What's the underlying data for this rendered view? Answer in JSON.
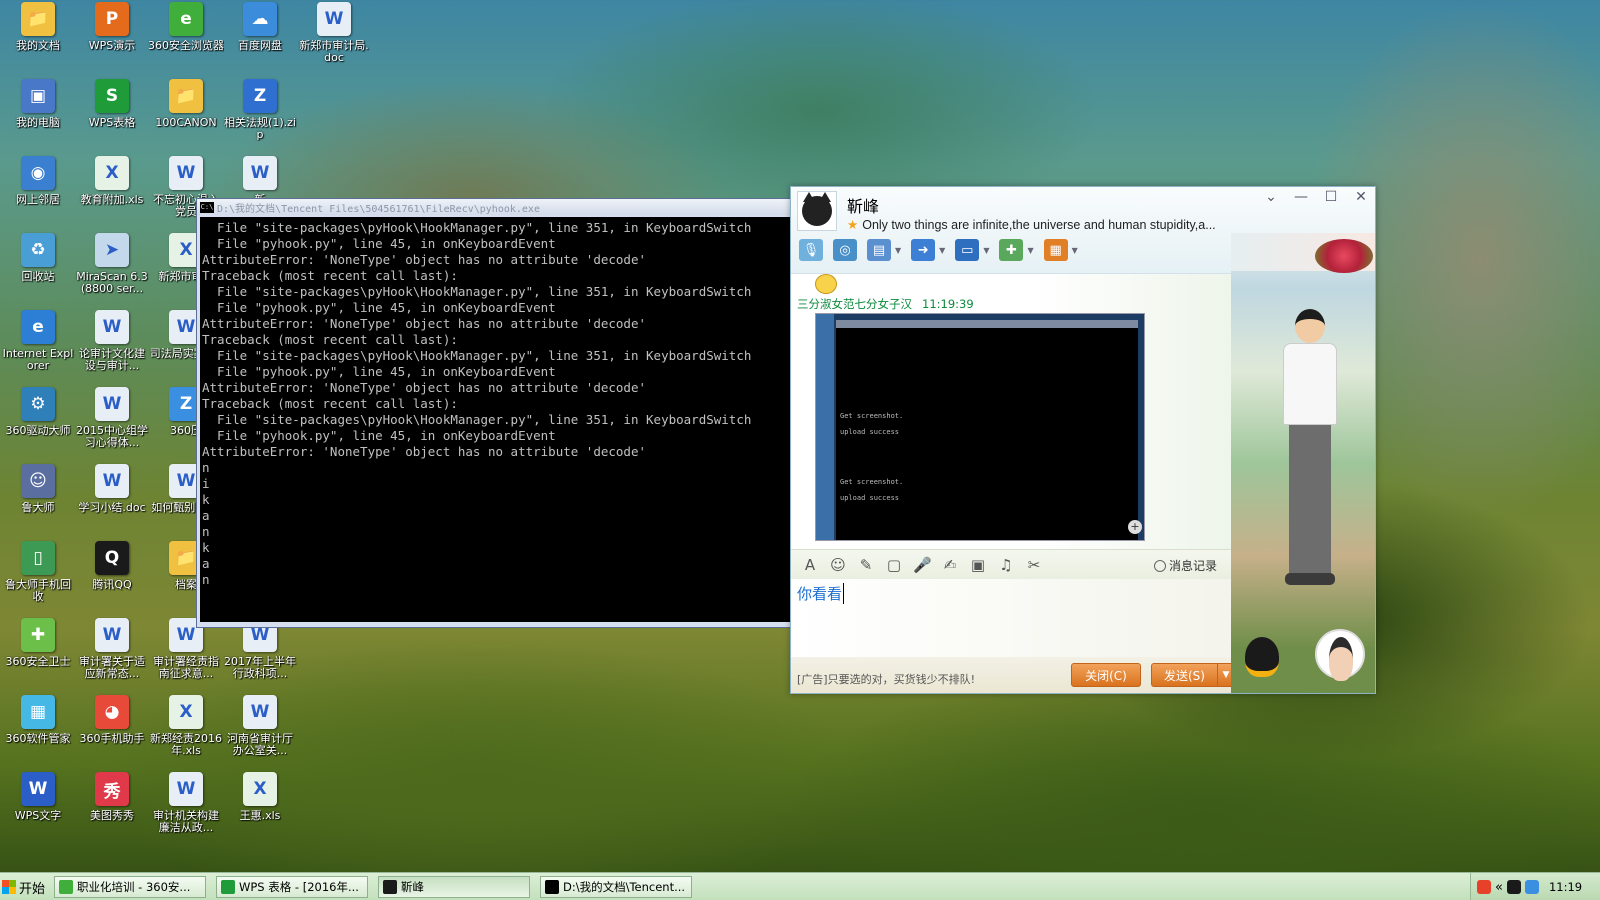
{
  "desktop_icons": [
    {
      "label": "我的文档",
      "glyph": "folder-icon",
      "color": "#f0c040",
      "symbol": "📁"
    },
    {
      "label": "WPS演示",
      "glyph": "wps-presentation-icon",
      "color": "#e46b1c",
      "symbol": "P"
    },
    {
      "label": "360安全浏览器",
      "glyph": "browser-icon",
      "color": "#3fae3a",
      "symbol": "e"
    },
    {
      "label": "百度网盘",
      "glyph": "cloud-icon",
      "color": "#3b8ddb",
      "symbol": "☁"
    },
    {
      "label": "新郑市审计局.doc",
      "glyph": "doc-icon",
      "color": "#e8eef6",
      "symbol": "W"
    },
    {
      "label": "我的电脑",
      "glyph": "computer-icon",
      "color": "#4a78c8",
      "symbol": "▣"
    },
    {
      "label": "WPS表格",
      "glyph": "wps-spreadsheet-icon",
      "color": "#1f9b3a",
      "symbol": "S"
    },
    {
      "label": "100CANON",
      "glyph": "folder-icon",
      "color": "#f0c040",
      "symbol": "📁"
    },
    {
      "label": "相关法规(1).zip",
      "glyph": "zip-icon",
      "color": "#2f6fcf",
      "symbol": "Z"
    },
    {
      "label": "网上邻居",
      "glyph": "network-icon",
      "color": "#3a7fd0",
      "symbol": "◉"
    },
    {
      "label": "教育附加.xls",
      "glyph": "xls-icon",
      "color": "#e6f2e6",
      "symbol": "X"
    },
    {
      "label": "不忘初心温入党员",
      "glyph": "doc-icon",
      "color": "#e8eef6",
      "symbol": "W"
    },
    {
      "label": "新",
      "glyph": "doc-icon",
      "color": "#e8eef6",
      "symbol": "W"
    },
    {
      "label": "回收站",
      "glyph": "recycle-bin-icon",
      "color": "#4a9ed6",
      "symbol": "♻"
    },
    {
      "label": "MiraScan 6.3 (8800 ser...",
      "glyph": "scanner-icon",
      "color": "#c4d8ec",
      "symbol": "➤"
    },
    {
      "label": "新郑市审计",
      "glyph": "xls-icon",
      "color": "#e6f2e6",
      "symbol": "X"
    },
    {
      "label": "Internet Explorer",
      "glyph": "ie-icon",
      "color": "#2c7fd4",
      "symbol": "e"
    },
    {
      "label": "论审计文化建设与审计...",
      "glyph": "doc-icon",
      "color": "#e8eef6",
      "symbol": "W"
    },
    {
      "label": "司法局实案5.d",
      "glyph": "doc-icon",
      "color": "#e8eef6",
      "symbol": "W"
    },
    {
      "label": "360驱动大师",
      "glyph": "driver-icon",
      "color": "#2f7fb8",
      "symbol": "⚙"
    },
    {
      "label": "2015中心组学习心得体...",
      "glyph": "doc-icon",
      "color": "#e8eef6",
      "symbol": "W"
    },
    {
      "label": "360压",
      "glyph": "zip-icon",
      "color": "#3a8fe0",
      "symbol": "Z"
    },
    {
      "label": "鲁大师",
      "glyph": "ludashi-icon",
      "color": "#5a6fa0",
      "symbol": "☺"
    },
    {
      "label": "学习小结.doc",
      "glyph": "doc-icon",
      "color": "#e8eef6",
      "symbol": "W"
    },
    {
      "label": "如何甄别真伪.",
      "glyph": "doc-icon",
      "color": "#e8eef6",
      "symbol": "W"
    },
    {
      "label": "鲁大师手机回收",
      "glyph": "phone-icon",
      "color": "#3c9a54",
      "symbol": "▯"
    },
    {
      "label": "腾讯QQ",
      "glyph": "qq-icon",
      "color": "#1a1a1a",
      "symbol": "Q"
    },
    {
      "label": "档案",
      "glyph": "folder-icon",
      "color": "#f0c040",
      "symbol": "📁"
    },
    {
      "label": "360安全卫士",
      "glyph": "shield-icon",
      "color": "#6cc04a",
      "symbol": "✚"
    },
    {
      "label": "审计署关于适应新常态...",
      "glyph": "doc-icon",
      "color": "#e8eef6",
      "symbol": "W"
    },
    {
      "label": "审计署经责指南征求意...",
      "glyph": "doc-icon",
      "color": "#e8eef6",
      "symbol": "W"
    },
    {
      "label": "2017年上半年行政科项...",
      "glyph": "doc-icon",
      "color": "#e8eef6",
      "symbol": "W"
    },
    {
      "label": "360软件管家",
      "glyph": "software-manager-icon",
      "color": "#46b8e6",
      "symbol": "▦"
    },
    {
      "label": "360手机助手",
      "glyph": "phone-assistant-icon",
      "color": "#e84a3a",
      "symbol": "◕"
    },
    {
      "label": "新郑经责2016年.xls",
      "glyph": "xls-icon",
      "color": "#e6f2e6",
      "symbol": "X"
    },
    {
      "label": "河南省审计厅办公室关...",
      "glyph": "doc-icon",
      "color": "#e8eef6",
      "symbol": "W"
    },
    {
      "label": "WPS文字",
      "glyph": "wps-writer-icon",
      "color": "#2b5fc7",
      "symbol": "W"
    },
    {
      "label": "美图秀秀",
      "glyph": "meitu-icon",
      "color": "#e0394a",
      "symbol": "秀"
    },
    {
      "label": "审计机关构建廉洁从政...",
      "glyph": "doc-icon",
      "color": "#e8eef6",
      "symbol": "W"
    },
    {
      "label": "王惠.xls",
      "glyph": "xls-icon",
      "color": "#e6f2e6",
      "symbol": "X"
    }
  ],
  "console": {
    "title": "D:\\我的文档\\Tencent Files\\504561761\\FileRecv\\pyhook.exe",
    "lines": [
      "  File \"site-packages\\pyHook\\HookManager.py\", line 351, in KeyboardSwitch",
      "  File \"pyhook.py\", line 45, in onKeyboardEvent",
      "AttributeError: 'NoneType' object has no attribute 'decode'",
      "Traceback (most recent call last):",
      "  File \"site-packages\\pyHook\\HookManager.py\", line 351, in KeyboardSwitch",
      "  File \"pyhook.py\", line 45, in onKeyboardEvent",
      "AttributeError: 'NoneType' object has no attribute 'decode'",
      "Traceback (most recent call last):",
      "  File \"site-packages\\pyHook\\HookManager.py\", line 351, in KeyboardSwitch",
      "  File \"pyhook.py\", line 45, in onKeyboardEvent",
      "AttributeError: 'NoneType' object has no attribute 'decode'",
      "Traceback (most recent call last):",
      "  File \"site-packages\\pyHook\\HookManager.py\", line 351, in KeyboardSwitch",
      "  File \"pyhook.py\", line 45, in onKeyboardEvent",
      "AttributeError: 'NoneType' object has no attribute 'decode'",
      "n",
      "i",
      "k",
      "a",
      "n",
      "k",
      "a",
      "n"
    ]
  },
  "qq": {
    "contact_name": "靳峰",
    "signature": "Only two things are infinite,the universe and human stupidity,a...",
    "window_buttons": {
      "dropdown": "⌄",
      "minimize": "—",
      "maximize": "☐",
      "close": "✕"
    },
    "toolbar_icons": [
      "voice-call-icon",
      "video-call-icon",
      "app-icon",
      "file-transfer-icon",
      "remote-desktop-icon",
      "group-chat-icon",
      "apps-grid-icon"
    ],
    "message": {
      "sender": "三分淑女范七分女子汉",
      "time": "11:19:39",
      "screenshot_lines": [
        "Get screenshot.",
        "upload success",
        "Get screenshot.",
        "upload success"
      ]
    },
    "input_toolbar_icons": [
      "font-icon",
      "emoji-icon",
      "shake-icon",
      "screenshot-icon",
      "voice-message-icon",
      "edit-icon",
      "image-icon",
      "music-icon",
      "scissors-icon"
    ],
    "history_label": "消息记录",
    "input_text": "你看看",
    "ad_text": "[广告]只要选的对，买货钱少不排队!",
    "close_button": "关闭(C)",
    "send_button": "发送(S)",
    "send_arrow": "▼"
  },
  "taskbar": {
    "start_label": "开始",
    "tasks": [
      {
        "label": "职业化培训 - 360安...",
        "icon_color": "#3fae3a",
        "active": false
      },
      {
        "label": "WPS 表格 - [2016年...",
        "icon_color": "#1f9b3a",
        "active": false
      },
      {
        "label": "靳峰",
        "icon_color": "#1a1a1a",
        "active": true
      },
      {
        "label": "D:\\我的文档\\Tencent...",
        "icon_color": "#000000",
        "active": false
      }
    ],
    "tray_arrow": "«",
    "clock": "11:19"
  }
}
